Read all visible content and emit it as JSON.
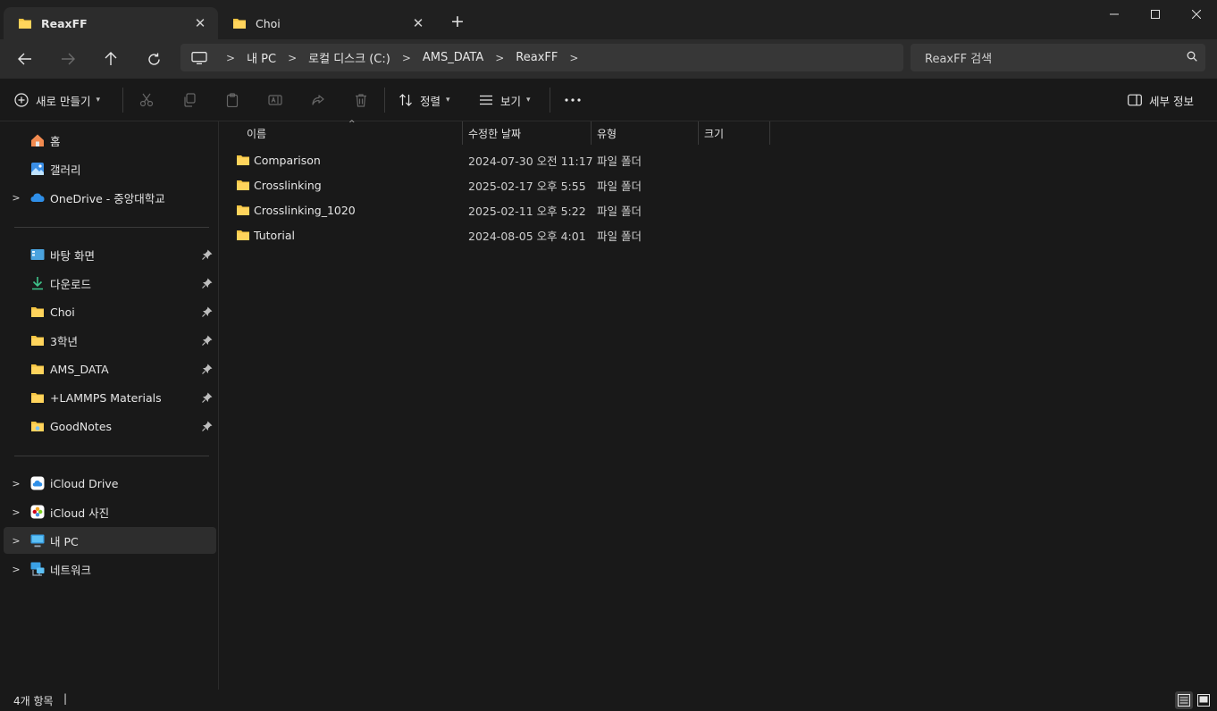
{
  "tabs": [
    {
      "label": "ReaxFF",
      "active": true
    },
    {
      "label": "Choi",
      "active": false
    }
  ],
  "address": {
    "crumbs": [
      "내 PC",
      "로컬 디스크 (C:)",
      "AMS_DATA",
      "ReaxFF"
    ]
  },
  "search": {
    "placeholder": "ReaxFF 검색"
  },
  "toolbar": {
    "new_label": "새로 만들기",
    "sort_label": "정렬",
    "view_label": "보기",
    "details_label": "세부 정보"
  },
  "sidebar": {
    "top": [
      {
        "label": "홈",
        "icon": "home-icon"
      },
      {
        "label": "갤러리",
        "icon": "gallery-icon"
      },
      {
        "label": "OneDrive - 중앙대학교",
        "icon": "cloud-icon"
      }
    ],
    "pinned": [
      {
        "label": "바탕 화면",
        "icon": "desktop-icon"
      },
      {
        "label": "다운로드",
        "icon": "download-icon"
      },
      {
        "label": "Choi",
        "icon": "folder-icon"
      },
      {
        "label": "3학년",
        "icon": "folder-icon"
      },
      {
        "label": "AMS_DATA",
        "icon": "folder-icon"
      },
      {
        "label": "+LAMMPS Materials",
        "icon": "folder-icon"
      },
      {
        "label": "GoodNotes",
        "icon": "folder-icon"
      }
    ],
    "bottom": [
      {
        "label": "iCloud Drive",
        "icon": "icloud-icon"
      },
      {
        "label": "iCloud 사진",
        "icon": "photos-icon"
      },
      {
        "label": "내 PC",
        "icon": "pc-icon"
      },
      {
        "label": "네트워크",
        "icon": "network-icon"
      }
    ]
  },
  "columns": {
    "name": "이름",
    "modified": "수정한 날짜",
    "type": "유형",
    "size": "크기"
  },
  "files": [
    {
      "name": "Comparison",
      "modified": "2024-07-30 오전 11:17",
      "type": "파일 폴더"
    },
    {
      "name": "Crosslinking",
      "modified": "2025-02-17 오후 5:55",
      "type": "파일 폴더"
    },
    {
      "name": "Crosslinking_1020",
      "modified": "2025-02-11 오후 5:22",
      "type": "파일 폴더"
    },
    {
      "name": "Tutorial",
      "modified": "2024-08-05 오후 4:01",
      "type": "파일 폴더"
    }
  ],
  "status": {
    "count": "4개 항목",
    "caret": "|"
  },
  "colors": {
    "folder": "#f4c542",
    "accent": "#4cc2ff"
  }
}
